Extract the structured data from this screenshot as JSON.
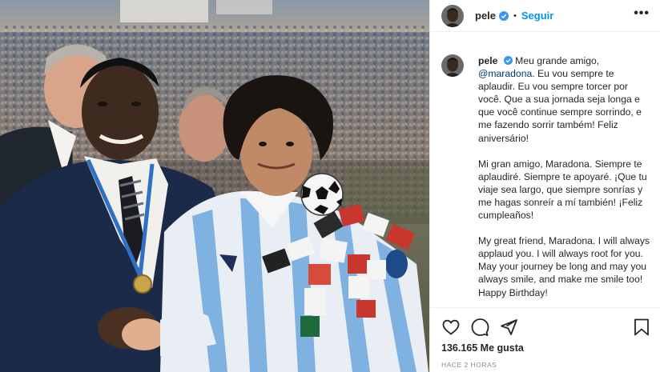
{
  "post": {
    "username": "pele",
    "follow_label": "Seguir",
    "dot": "•",
    "more_label": "•••",
    "caption": {
      "username": "pele",
      "line1": "Meu grande amigo,",
      "mention": "@maradona",
      "pt_rest": ". Eu vou sempre te aplaudir. Eu vou sempre torcer por você. Que a sua jornada seja longa e que você continue sempre sorrindo, e me fazendo sorrir também! Feliz aniversário!",
      "es": "Mi gran amigo, Maradona. Siempre te aplaudiré. Siempre te apoyaré. ¡Que tu viaje sea largo, que siempre sonrías y me hagas sonreír a mí también! ¡Feliz cumpleaños!",
      "en": "My great friend, Maradona. I will always applaud you. I will always root for you. May your journey be long and may you always smile, and make me smile too! Happy Birthday!"
    },
    "likes": "136.165 Me gusta",
    "time": "HACE 2 HORAS"
  },
  "icons": {
    "like": "heart-icon",
    "comment": "comment-icon",
    "share": "share-icon",
    "save": "bookmark-icon",
    "verified": "verified-badge-icon"
  },
  "colors": {
    "link": "#0095f6",
    "mention": "#00376b",
    "muted": "#8e8e8e",
    "text": "#262626",
    "border": "#efefef"
  }
}
